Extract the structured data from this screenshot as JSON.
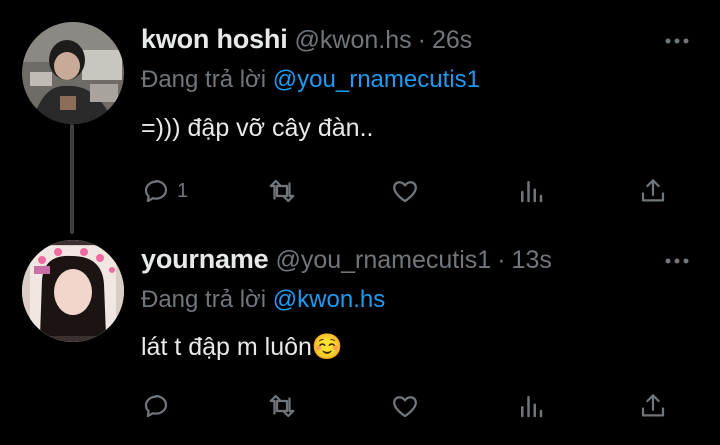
{
  "colors": {
    "background": "#000000",
    "primary_text": "#e7e9ea",
    "secondary_text": "#71767b",
    "link": "#1d9bf0",
    "thread_line": "#3e4144"
  },
  "tweets": [
    {
      "name": "kwon hoshi",
      "handle": "@kwon.hs",
      "dot": "·",
      "time": "26s",
      "reply_prefix": "Đang trả lời ",
      "reply_mention": "@you_rnamecutis1",
      "text": "=))) đập vỡ cây đàn..",
      "reply_count": "1",
      "icons": [
        "more-icon",
        "reply-icon",
        "retweet-icon",
        "like-icon",
        "views-icon",
        "share-icon"
      ]
    },
    {
      "name": "yourname",
      "handle": "@you_rnamecutis1",
      "dot": "·",
      "time": "13s",
      "reply_prefix": "Đang trả lời ",
      "reply_mention": "@kwon.hs",
      "text": "lát t đập m luôn☺️",
      "reply_count": "",
      "icons": [
        "more-icon",
        "reply-icon",
        "retweet-icon",
        "like-icon",
        "views-icon",
        "share-icon"
      ]
    }
  ]
}
